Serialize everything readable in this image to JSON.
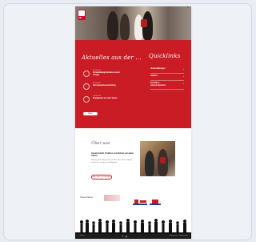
{
  "hero": {
    "logo_text": "AB",
    "close_label": "×"
  },
  "news": {
    "heading": "Aktuelles aus der ...",
    "items": [
      {
        "date": "00.00.0000",
        "title": "Veranstaltungshinweis unserer Gruppe"
      },
      {
        "date": "00.00.0000",
        "title": "Jahreshauptversammlung"
      },
      {
        "date": "00.00.0000",
        "title": "Neuigkeiten aus dem Verein"
      }
    ],
    "button_label": "Mehr"
  },
  "quicklinks": {
    "heading": "Quicklinks",
    "items": [
      {
        "label": "Veranstaltungen"
      },
      {
        "label": "Anfahrt"
      },
      {
        "label": "Kontakt & Ansprechpartner"
      }
    ]
  },
  "about": {
    "heading": "Über uns",
    "subheading": "Gemeinschaft, Tradition und Heimat seit vielen Jahren",
    "body": "Wir pflegen das Brauchtum und die Tracht unserer Region und freuen uns über neue Mitglieder.",
    "button_label": "Mehr über uns erfahren"
  },
  "partners": {
    "label": "Unsere Partner"
  },
  "footer": {
    "left_text": "© Verein",
    "icons": "f ◎",
    "right_text": "Impressum · Datenschutz"
  },
  "colors": {
    "brand_red": "#c91c24",
    "footer_bg": "#1c1c1c"
  }
}
